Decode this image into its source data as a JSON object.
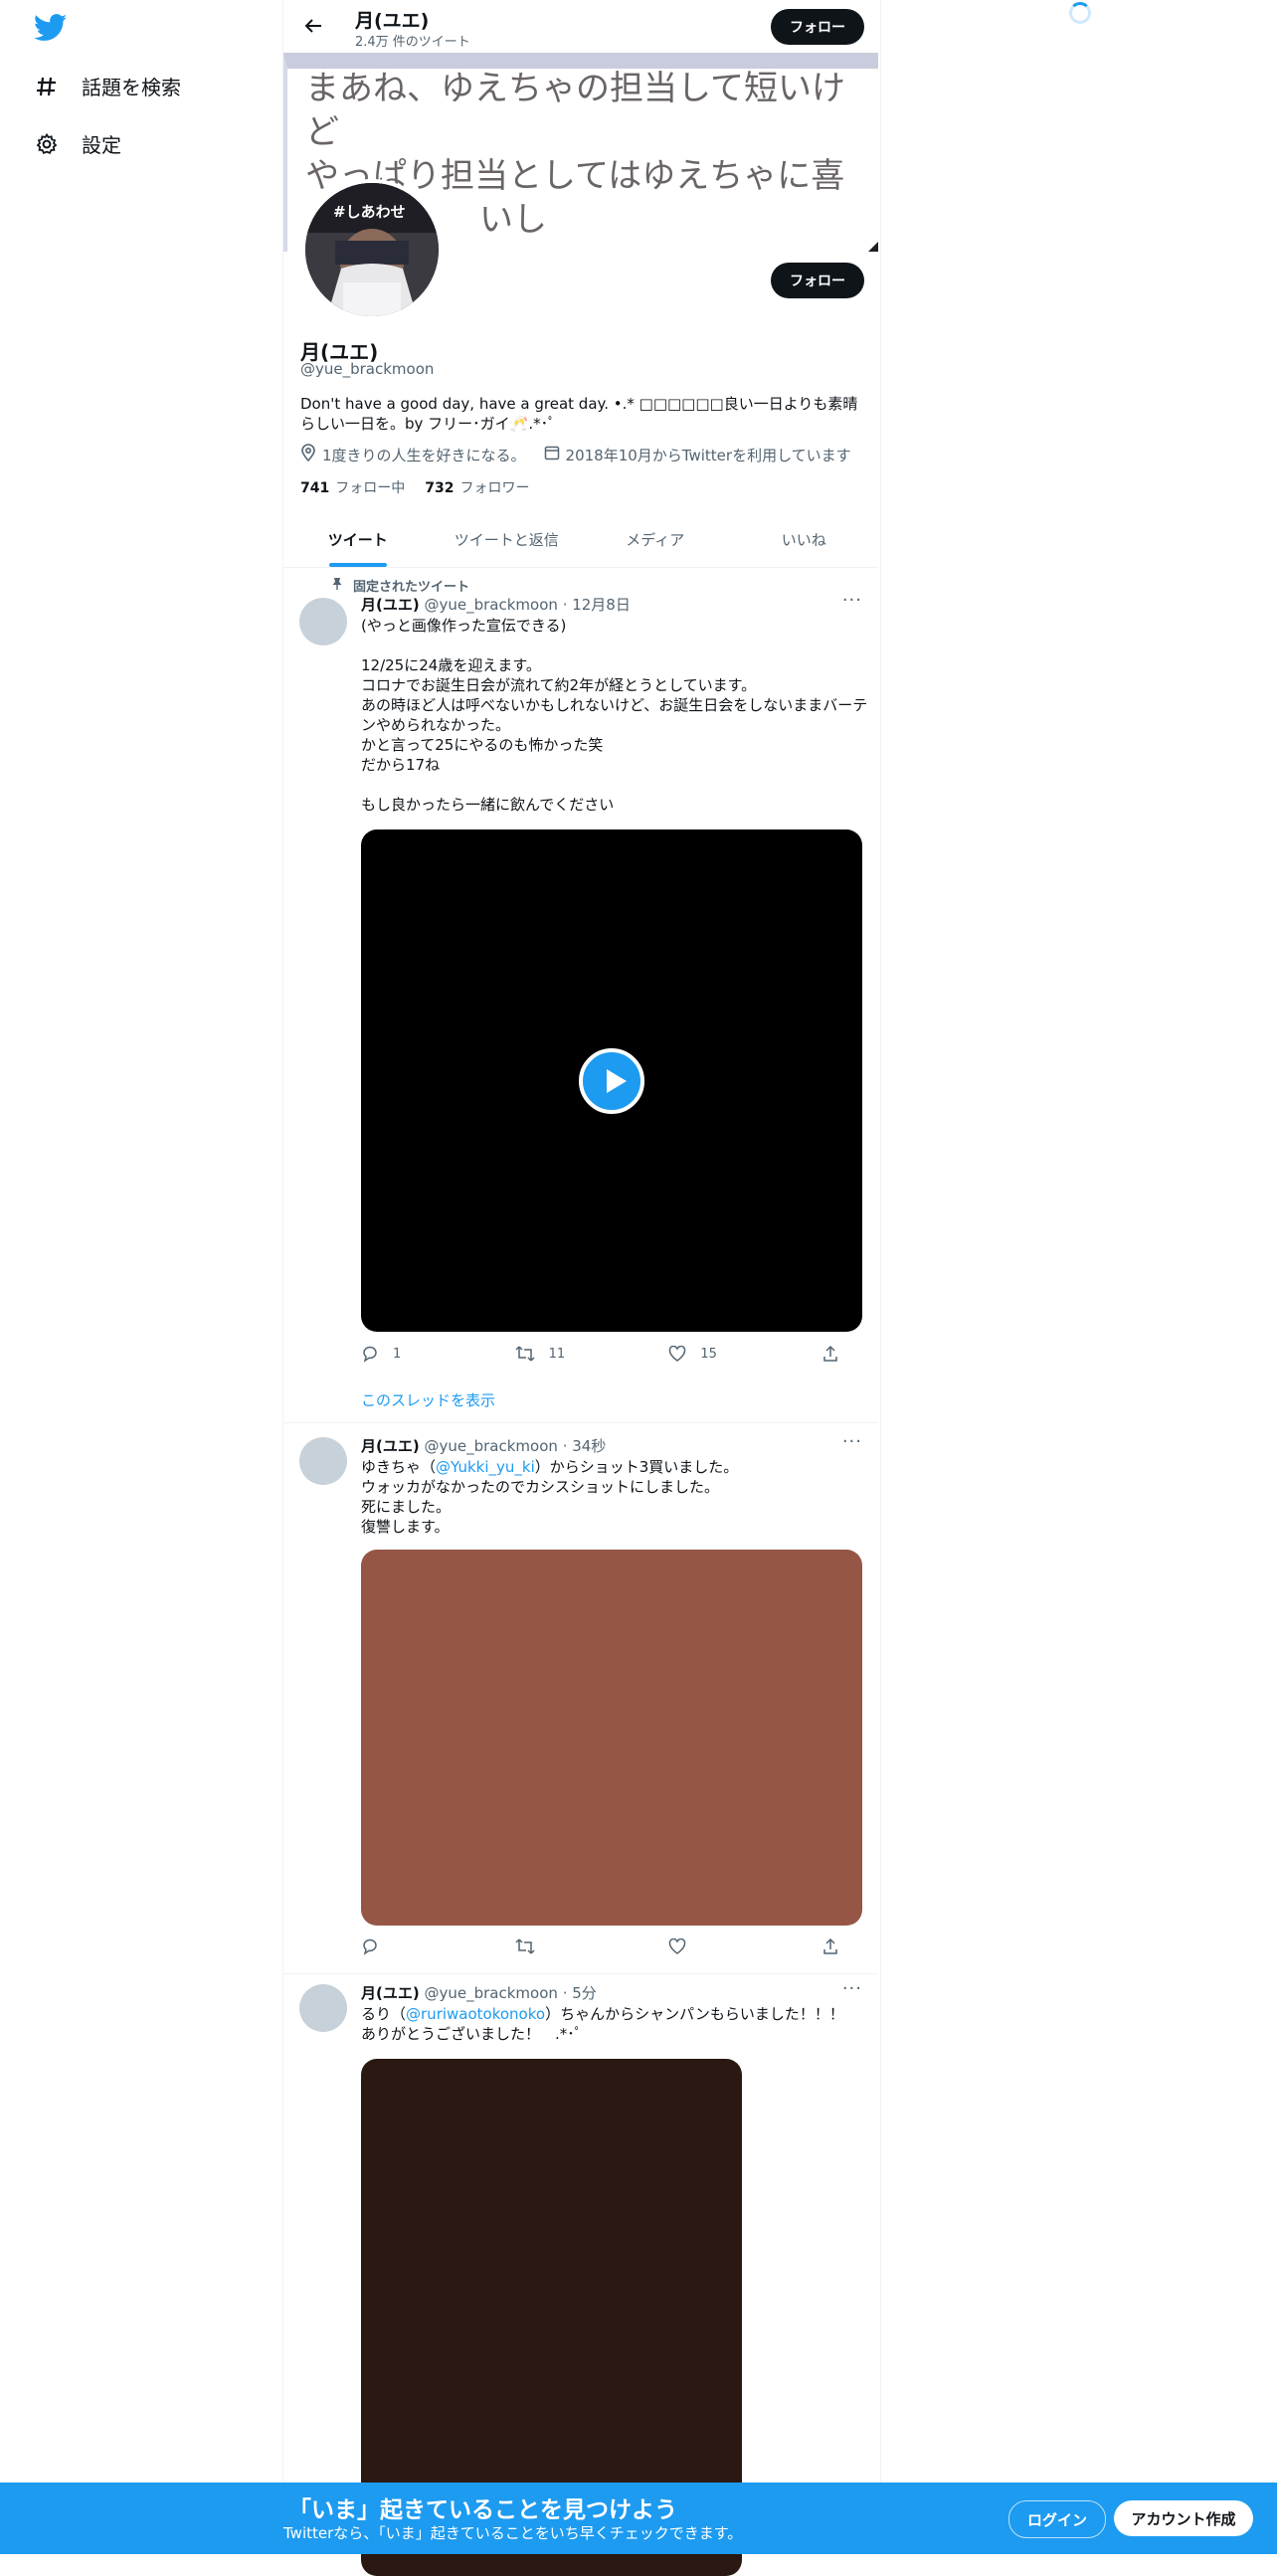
{
  "sidebar": {
    "items": [
      {
        "label": "話題を検索",
        "icon": "hashtag-icon"
      },
      {
        "label": "設定",
        "icon": "gear-icon"
      }
    ]
  },
  "header": {
    "name": "月(ユエ)",
    "tweet_count": "2.4万 件のツイート",
    "follow_label": "フォロー"
  },
  "banner": {
    "text_line1": "まあね、ゆえちゃの担当して短いけど",
    "text_line2": "やっぱり担当としてはゆえちゃに喜",
    "text_line3": "いし"
  },
  "profile": {
    "avatar_badge": "#しあわせ",
    "follow_label": "フォロー",
    "name": "月(ユエ)",
    "handle": "@yue_brackmoon",
    "bio": "Don't have a good day, have a great day. •.* □□□□□□良い一日よりも素晴らしい一日を。by フリー･ガイ🥂.*･ﾟ",
    "location": "1度きりの人生を好きになる。",
    "joined": "2018年10月からTwitterを利用しています",
    "following_count": "741",
    "following_label": "フォロー中",
    "followers_count": "732",
    "followers_label": "フォロワー"
  },
  "tabs": [
    {
      "label": "ツイート",
      "active": true
    },
    {
      "label": "ツイートと返信",
      "active": false
    },
    {
      "label": "メディア",
      "active": false
    },
    {
      "label": "いいね",
      "active": false
    }
  ],
  "tweets": [
    {
      "pinned_label": "固定されたツイート",
      "name": "月(ユエ)",
      "handle": "@yue_brackmoon",
      "time": "· 12月8日",
      "body": "(やっと画像作った宣伝できる)\n\n12/25に24歳を迎えます。\nコロナでお誕生日会が流れて約2年が経とうとしています。\nあの時ほど人は呼べないかもしれないけど、お誕生日会をしないままバーテンやめられなかった。\nかと言って25にやるのも怖かった笑\nだから17ね\n\nもし良かったら一緒に飲んでください",
      "reply_count": "1",
      "retweet_count": "11",
      "like_count": "15",
      "thread_link": "このスレッドを表示"
    },
    {
      "name": "月(ユエ)",
      "handle": "@yue_brackmoon",
      "time": "· 34秒",
      "body_pre": "ゆきちゃ（",
      "mention": "@Yukki_yu_ki",
      "body_post": "）からショット3買いました。\nウォッカがなかったのでカシスショットにしました。\n死にました。\n復讐します。",
      "media_color": "#955645"
    },
    {
      "name": "月(ユエ)",
      "handle": "@yue_brackmoon",
      "time": "· 5分",
      "body_pre": "るり（",
      "mention": "@ruriwaotokonoko",
      "body_post": "）ちゃんからシャンパンもらいました！！！\nありがとうございました！　.*･ﾟ",
      "media_color": "#2a1812"
    }
  ],
  "bottom_bar": {
    "title": "「いま」起きていることを見つけよう",
    "subtitle": "Twitterなら、「いま」起きていることをいち早くチェックできます。",
    "login_label": "ログイン",
    "signup_label": "アカウント作成"
  },
  "colors": {
    "accent": "#1d9bf0",
    "text": "#0f1419",
    "muted": "#536471"
  }
}
